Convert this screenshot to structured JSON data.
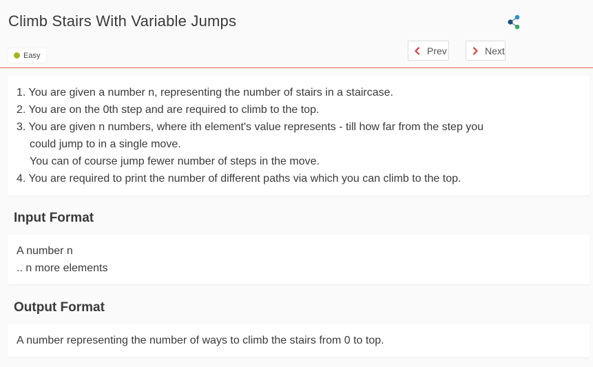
{
  "problem": {
    "title": "Climb Stairs With Variable Jumps",
    "difficulty": "Easy",
    "difficulty_color": "#a6b51b"
  },
  "nav": {
    "prev_label": "Prev",
    "next_label": "Next",
    "chevron_color": "#e03b3b"
  },
  "description": {
    "lines": [
      "1. You are given a number n, representing the number of stairs in a staircase.",
      "2. You are on the 0th step and are required to climb to the top.",
      "3. You are given n numbers, where ith element's value represents - till how far from the step you",
      "could jump to in a single move.",
      "You can of course jump fewer number of steps in the move.",
      "4. You are required to print the number of different paths via which you can climb to the top."
    ]
  },
  "input_format": {
    "heading": "Input Format",
    "lines": [
      "A number n",
      ".. n more elements"
    ]
  },
  "output_format": {
    "heading": "Output Format",
    "lines": [
      "A number representing the number of ways to climb the stairs from 0 to top."
    ]
  },
  "icons": {
    "share": "share-icon",
    "prev": "chevron-left-icon",
    "next": "chevron-right-icon"
  }
}
